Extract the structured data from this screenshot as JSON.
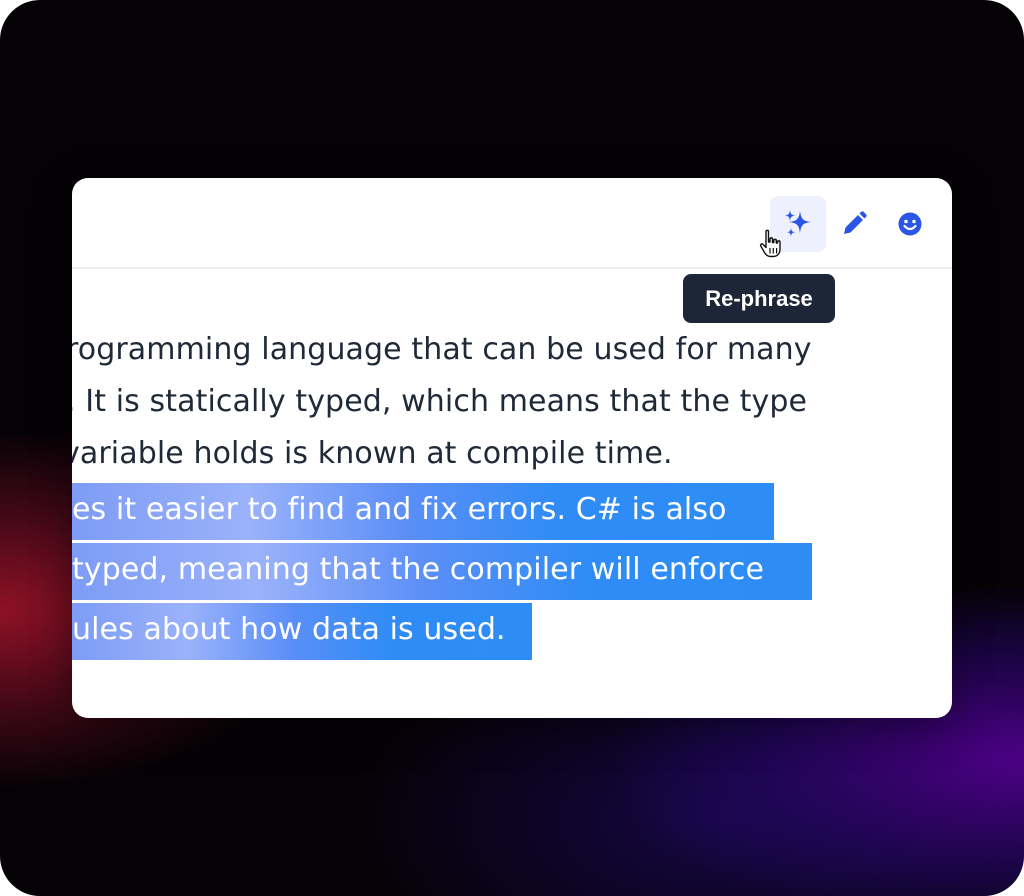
{
  "toolbar": {
    "buttons": [
      {
        "name": "rephrase",
        "icon": "sparkles-icon",
        "active": true
      },
      {
        "name": "edit",
        "icon": "pencil-icon",
        "active": false
      },
      {
        "name": "emoji",
        "icon": "smiley-icon",
        "active": false
      }
    ],
    "tooltip": "Re-phrase"
  },
  "content": {
    "lines": [
      "rogramming language that can be used for many",
      ". It is statically typed, which means that the type",
      " variable holds is known at compile time."
    ],
    "selected_lines": [
      "es it easier to find and fix errors. C# is also",
      "typed, meaning that the compiler will enforce",
      "ules about how data is used."
    ]
  },
  "colors": {
    "accent": "#2b55e6",
    "tooltip_bg": "#1c2636",
    "selection": "#2f8cf6",
    "text": "#1f2937"
  }
}
